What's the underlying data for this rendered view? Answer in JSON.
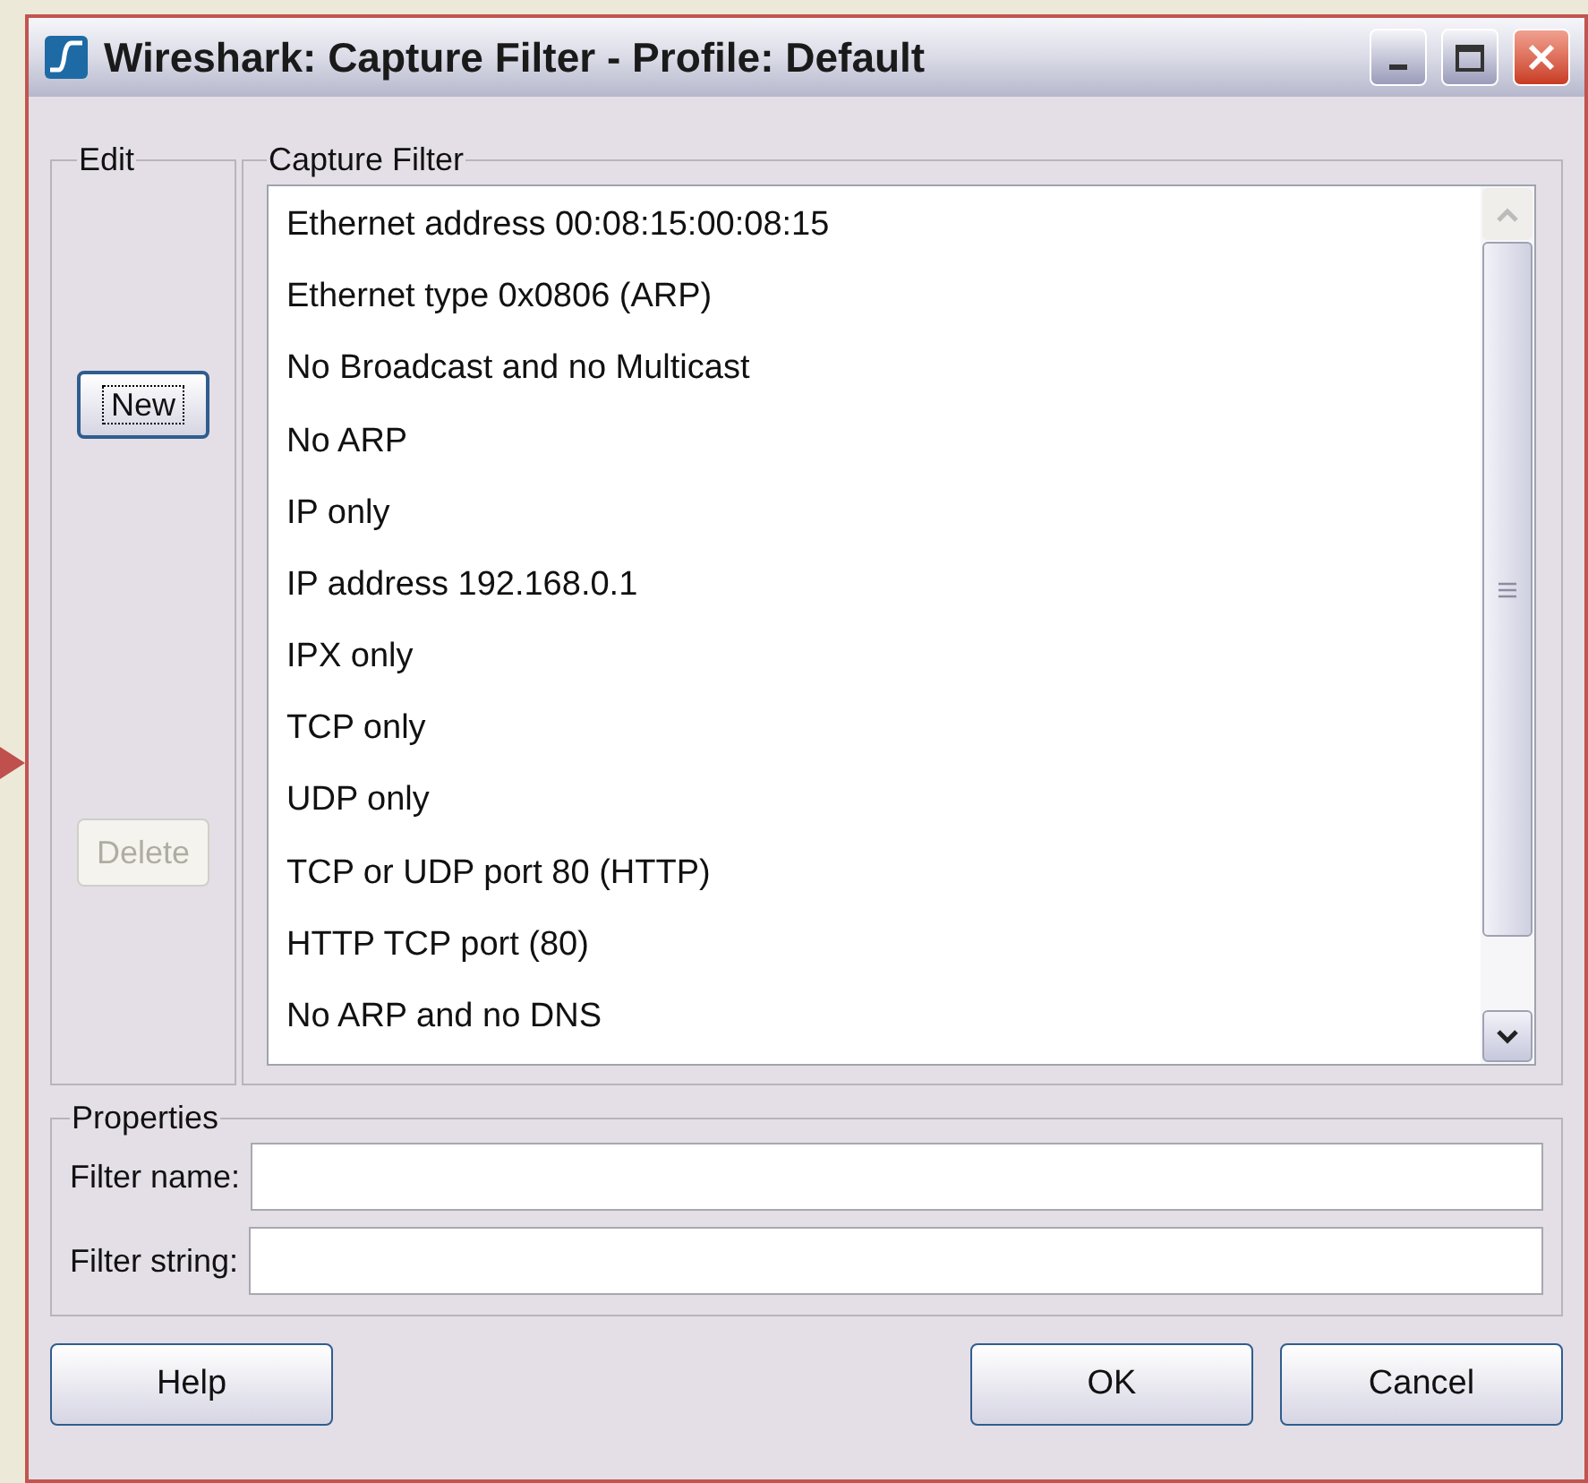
{
  "window": {
    "title": "Wireshark: Capture Filter - Profile: Default"
  },
  "edit": {
    "legend": "Edit",
    "buttons": [
      {
        "label": "New",
        "disabled": false,
        "focused": true
      },
      {
        "label": "Delete",
        "disabled": true,
        "focused": false
      }
    ]
  },
  "capture_filter": {
    "legend": "Capture Filter",
    "items": [
      {
        "label": "Ethernet address 00:08:15:00:08:15",
        "selected": false
      },
      {
        "label": "Ethernet type 0x0806 (ARP)",
        "selected": false
      },
      {
        "label": "No Broadcast and no Multicast",
        "selected": false
      },
      {
        "label": "No ARP",
        "selected": false
      },
      {
        "label": "IP only",
        "selected": false
      },
      {
        "label": "IP address 192.168.0.1",
        "selected": false
      },
      {
        "label": "IPX only",
        "selected": false
      },
      {
        "label": "TCP only",
        "selected": false
      },
      {
        "label": "UDP only",
        "selected": false
      },
      {
        "label": "TCP or UDP port 80 (HTTP)",
        "selected": false
      },
      {
        "label": "HTTP TCP port (80)",
        "selected": false
      },
      {
        "label": "No ARP and no DNS",
        "selected": false
      }
    ]
  },
  "properties": {
    "legend": "Properties",
    "fields": [
      {
        "label": "Filter name:"
      },
      {
        "label": "Filter string:"
      }
    ]
  },
  "buttons": [
    {
      "label": "Help"
    },
    {
      "label": "OK"
    },
    {
      "label": "Cancel"
    }
  ]
}
